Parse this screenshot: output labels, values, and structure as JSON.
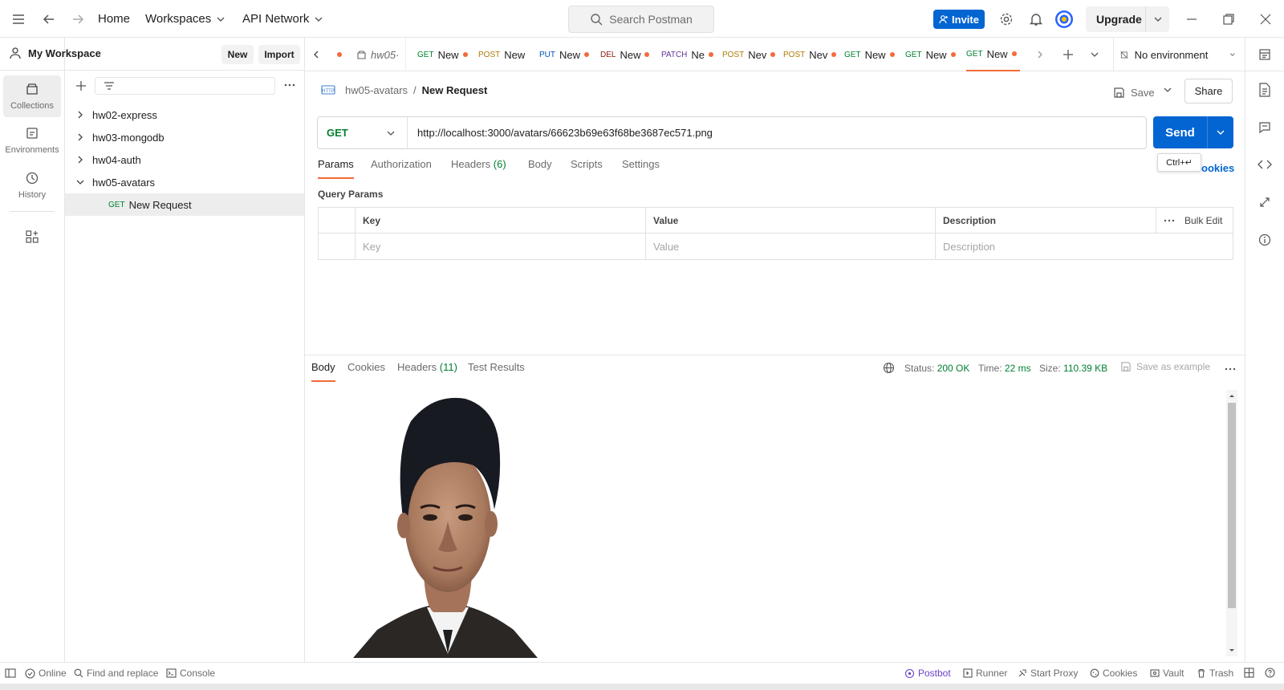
{
  "topbar": {
    "home": "Home",
    "workspaces": "Workspaces",
    "api_network": "API Network",
    "search_placeholder": "Search Postman",
    "invite": "Invite",
    "upgrade": "Upgrade"
  },
  "leftnav": {
    "collections": "Collections",
    "environments": "Environments",
    "history": "History"
  },
  "sidebar": {
    "workspace": "My Workspace",
    "new": "New",
    "import": "Import",
    "collections": [
      {
        "label": "hw02-express"
      },
      {
        "label": "hw03-mongodb"
      },
      {
        "label": "hw04-auth"
      },
      {
        "label": "hw05-avatars"
      }
    ],
    "request": {
      "method": "GET",
      "label": "New Request"
    }
  },
  "tabs": {
    "items": [
      {
        "method": "",
        "label": "hw05·"
      },
      {
        "method": "GET",
        "label": "New"
      },
      {
        "method": "POST",
        "label": "New"
      },
      {
        "method": "PUT",
        "label": "New"
      },
      {
        "method": "DEL",
        "label": "New"
      },
      {
        "method": "PATCH",
        "label": "Ne"
      },
      {
        "method": "POST",
        "label": "Nev"
      },
      {
        "method": "POST",
        "label": "Nev"
      },
      {
        "method": "GET",
        "label": "New"
      },
      {
        "method": "GET",
        "label": "New"
      },
      {
        "method": "GET",
        "label": "New"
      }
    ],
    "environment": "No environment"
  },
  "request": {
    "breadcrumb_collection": "hw05-avatars",
    "breadcrumb_sep": "/",
    "title": "New Request",
    "save": "Save",
    "share": "Share",
    "method": "GET",
    "url": "http://localhost:3000/avatars/66623b69e63f68be3687ec571.png",
    "send": "Send",
    "tooltip": "Ctrl+↵",
    "cookies_link": "ookies",
    "subtabs": {
      "params": "Params",
      "authorization": "Authorization",
      "headers": "Headers",
      "headers_count": "(6)",
      "body": "Body",
      "scripts": "Scripts",
      "settings": "Settings"
    },
    "query_params_title": "Query Params",
    "table": {
      "key": "Key",
      "value": "Value",
      "description": "Description",
      "bulk_edit": "Bulk Edit",
      "key_ph": "Key",
      "value_ph": "Value",
      "description_ph": "Description"
    }
  },
  "response": {
    "tabs": {
      "body": "Body",
      "cookies": "Cookies",
      "headers": "Headers",
      "headers_count": "(11)",
      "test_results": "Test Results"
    },
    "status_label": "Status:",
    "status_value": "200 OK",
    "time_label": "Time:",
    "time_value": "22 ms",
    "size_label": "Size:",
    "size_value": "110.39 KB",
    "save_example": "Save as example"
  },
  "footer": {
    "online": "Online",
    "find_replace": "Find and replace",
    "console": "Console",
    "postbot": "Postbot",
    "runner": "Runner",
    "start_proxy": "Start Proxy",
    "cookies": "Cookies",
    "vault": "Vault",
    "trash": "Trash"
  },
  "colors": {
    "primary": "#0265d2",
    "accent_orange": "#f26b3a",
    "green": "#007f31"
  }
}
